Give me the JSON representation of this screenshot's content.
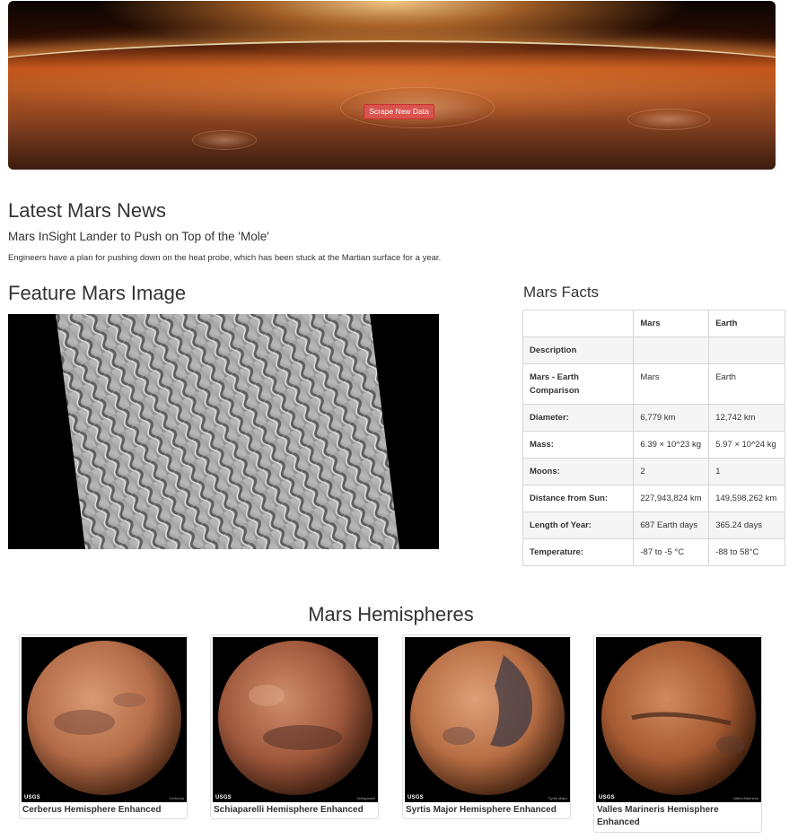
{
  "hero": {
    "button_label": "Scrape New Data"
  },
  "news": {
    "heading": "Latest Mars News",
    "title": "Mars InSight Lander to Push on Top of the 'Mole'",
    "teaser": "Engineers have a plan for pushing down on the heat probe, which has been stuck at the Martian surface for a year."
  },
  "featured": {
    "heading": "Feature Mars Image"
  },
  "facts": {
    "heading": "Mars Facts",
    "columns": [
      "",
      "Mars",
      "Earth"
    ],
    "rows": [
      {
        "label": "Description",
        "mars": "",
        "earth": ""
      },
      {
        "label": "Mars - Earth Comparison",
        "mars": "Mars",
        "earth": "Earth"
      },
      {
        "label": "Diameter:",
        "mars": "6,779 km",
        "earth": "12,742 km"
      },
      {
        "label": "Mass:",
        "mars": "6.39 × 10^23 kg",
        "earth": "5.97 × 10^24 kg"
      },
      {
        "label": "Moons:",
        "mars": "2",
        "earth": "1"
      },
      {
        "label": "Distance from Sun:",
        "mars": "227,943,824 km",
        "earth": "149,598,262 km"
      },
      {
        "label": "Length of Year:",
        "mars": "687 Earth days",
        "earth": "365.24 days"
      },
      {
        "label": "Temperature:",
        "mars": "-87 to -5 °C",
        "earth": "-88 to 58°C"
      }
    ]
  },
  "hemispheres": {
    "heading": "Mars Hemispheres",
    "items": [
      {
        "title": "Cerberus Hemisphere Enhanced",
        "badge": "USGS",
        "corner": "Cerberus"
      },
      {
        "title": "Schiaparelli Hemisphere Enhanced",
        "badge": "USGS",
        "corner": "Schiaparelli"
      },
      {
        "title": "Syrtis Major Hemisphere Enhanced",
        "badge": "USGS",
        "corner": "Syrtis Major"
      },
      {
        "title": "Valles Marineris Hemisphere Enhanced",
        "badge": "USGS",
        "corner": "Valles Marineris"
      }
    ]
  }
}
